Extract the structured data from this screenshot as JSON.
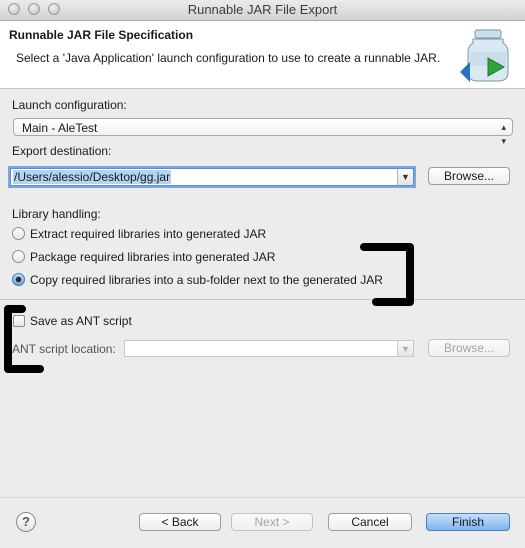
{
  "window": {
    "title": "Runnable JAR File Export"
  },
  "banner": {
    "title": "Runnable JAR File Specification",
    "description": "Select a 'Java Application' launch configuration to use to create a runnable JAR."
  },
  "launch": {
    "label": "Launch configuration:",
    "value": "Main - AleTest"
  },
  "export": {
    "label": "Export destination:",
    "value": "/Users/alessio/Desktop/gg.jar",
    "browse": "Browse..."
  },
  "library": {
    "label": "Library handling:",
    "options": [
      "Extract required libraries into generated JAR",
      "Package required libraries into generated JAR",
      "Copy required libraries into a sub-folder next to the generated JAR"
    ],
    "selected": 2
  },
  "ant": {
    "checkbox_label": "Save as ANT script",
    "location_label": "ANT script location:",
    "location_value": "",
    "browse": "Browse..."
  },
  "footer": {
    "back": "< Back",
    "next": "Next >",
    "cancel": "Cancel",
    "finish": "Finish",
    "help": "?"
  },
  "colors": {
    "accent": "#7fb4ef",
    "selection": "#b3d2f6",
    "annotation": "#000000"
  }
}
